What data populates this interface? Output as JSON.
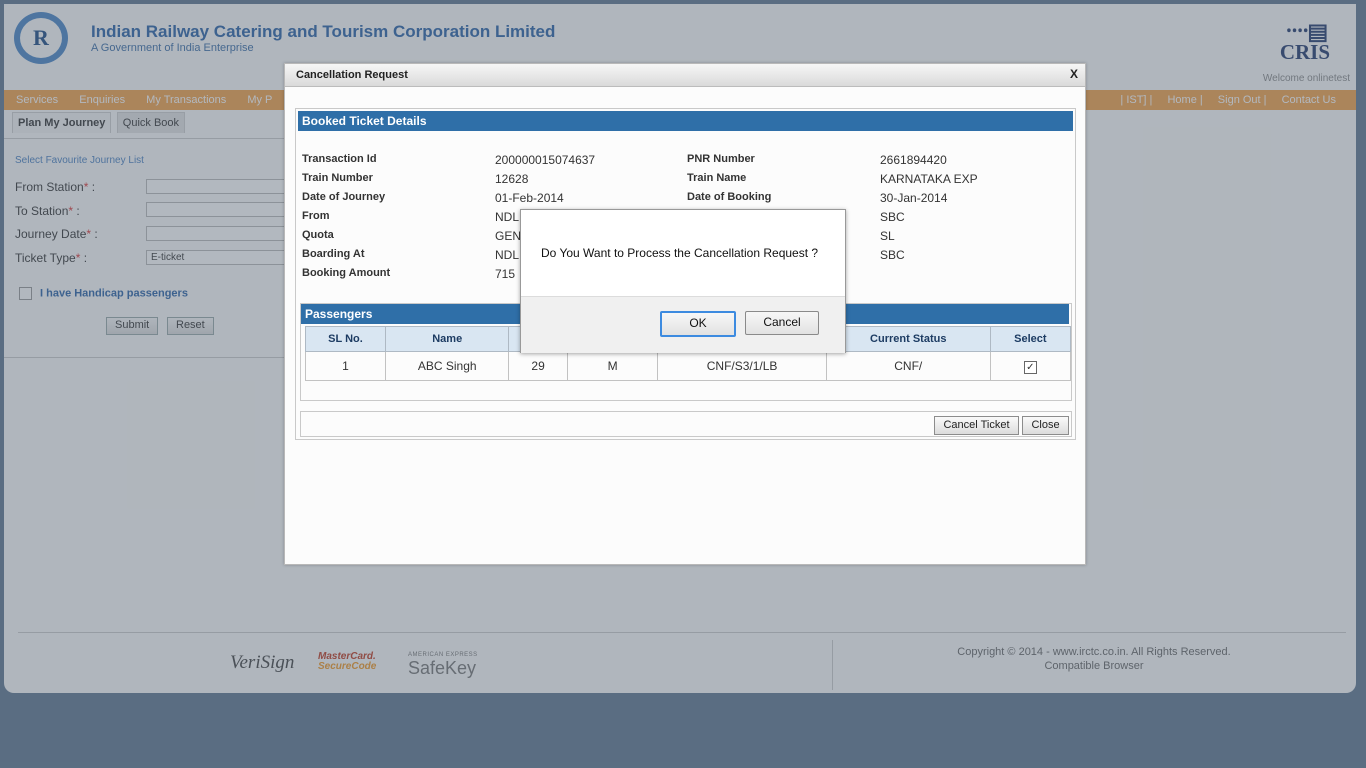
{
  "header": {
    "org_name": "Indian Railway Catering and Tourism Corporation Limited",
    "org_sub": "A Government of India Enterprise",
    "logo_text": "R",
    "cris_label": "CRIS",
    "welcome": "Welcome onlinetest"
  },
  "nav": {
    "left": [
      "Services",
      "Enquiries",
      "My Transactions",
      "My P"
    ],
    "right": [
      "| IST] |",
      "Home |",
      "Sign Out |",
      "Contact Us"
    ]
  },
  "tabs": [
    "Plan My Journey",
    "Quick Book"
  ],
  "journey_form": {
    "fav_link": "Select Favourite Journey List",
    "from_label": "From Station",
    "to_label": "To Station",
    "date_label": "Journey Date",
    "ticket_type_label": "Ticket Type",
    "req": "*",
    "colon": " :",
    "ticket_type_value": "E-ticket",
    "handicap_label": "I have Handicap passengers",
    "submit": "Submit",
    "reset": "Reset"
  },
  "footer": {
    "verisign": "VeriSign",
    "mastercard_top": "MasterCard.",
    "mastercard_sub": "SecureCode",
    "amex_top": "AMERICAN EXPRESS",
    "amex_main": "SafeKey",
    "copyright": "Copyright © 2014 - www.irctc.co.in. All Rights Reserved.",
    "compatible": "Compatible Browser"
  },
  "cancel_window": {
    "title": "Cancellation Request",
    "close_x": "X",
    "booked_header": "Booked Ticket Details",
    "details_left": [
      {
        "label": "Transaction Id",
        "value": "200000015074637"
      },
      {
        "label": "Train Number",
        "value": "12628"
      },
      {
        "label": "Date of Journey",
        "value": "01-Feb-2014"
      },
      {
        "label": "From",
        "value": "NDL"
      },
      {
        "label": "Quota",
        "value": "GEN"
      },
      {
        "label": "Boarding At",
        "value": "NDL"
      },
      {
        "label": "Booking Amount",
        "value": "715"
      }
    ],
    "details_right": [
      {
        "label": "PNR Number",
        "value": "2661894420"
      },
      {
        "label": "Train Name",
        "value": "KARNATAKA EXP"
      },
      {
        "label": "Date of Booking",
        "value": "30-Jan-2014"
      },
      {
        "label": "",
        "value": "SBC"
      },
      {
        "label": "",
        "value": "SL"
      },
      {
        "label": "",
        "value": "SBC"
      }
    ],
    "passengers_header": "Passengers",
    "columns": [
      "SL No.",
      "Name",
      "",
      "",
      "",
      "Current Status",
      "Select"
    ],
    "rows": [
      [
        "1",
        "ABC Singh",
        "29",
        "M",
        "CNF/S3/1/LB",
        "CNF/",
        "✓"
      ]
    ],
    "cancel_ticket_btn": "Cancel Ticket",
    "close_btn": "Close"
  },
  "confirm": {
    "message": "Do You Want to Process the Cancellation Request ?",
    "ok": "OK",
    "cancel": "Cancel"
  }
}
